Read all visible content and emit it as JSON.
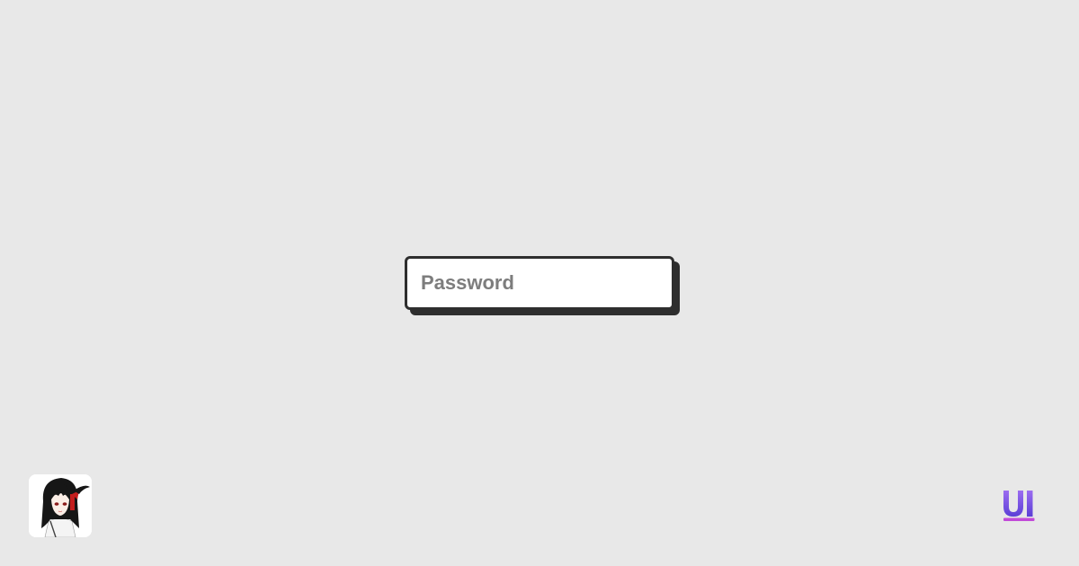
{
  "colors": {
    "background": "#e8e8e8",
    "input_border": "#2e2e2e",
    "input_shadow": "#2e2e2e",
    "input_background": "#ffffff",
    "placeholder": "#7d7d7d",
    "logo_gradient_start": "#9b6cf0",
    "logo_gradient_end": "#5b3fd6",
    "logo_underline": "#c24ad8"
  },
  "password_field": {
    "placeholder": "Password",
    "value": "",
    "type": "password"
  },
  "footer": {
    "avatar_icon": "anime-character-avatar",
    "brand_logo_icon": "ui-logo-icon",
    "brand_logo_text": "UI"
  }
}
